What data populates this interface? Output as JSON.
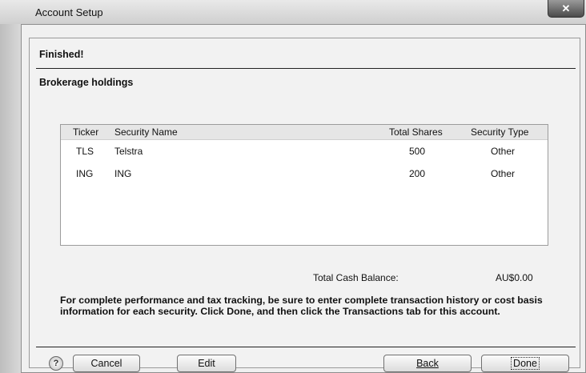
{
  "window": {
    "title": "Account Setup"
  },
  "pane": {
    "finished": "Finished!",
    "section": "Brokerage holdings"
  },
  "table": {
    "columns": [
      "Ticker",
      "Security Name",
      "Total Shares",
      "Security Type"
    ],
    "rows": [
      [
        "TLS",
        "Telstra",
        "500",
        "Other"
      ],
      [
        "ING",
        "ING",
        "200",
        "Other"
      ]
    ]
  },
  "cash": {
    "label": "Total Cash Balance:",
    "value": "AU$0.00"
  },
  "info": "For complete performance and tax tracking, be sure to enter complete transaction history or cost basis information for each security.  Click Done, and then click the Transactions tab for this account.",
  "buttons": {
    "help": "?",
    "cancel": "Cancel",
    "edit": "Edit",
    "back": "Back",
    "done": "Done"
  }
}
